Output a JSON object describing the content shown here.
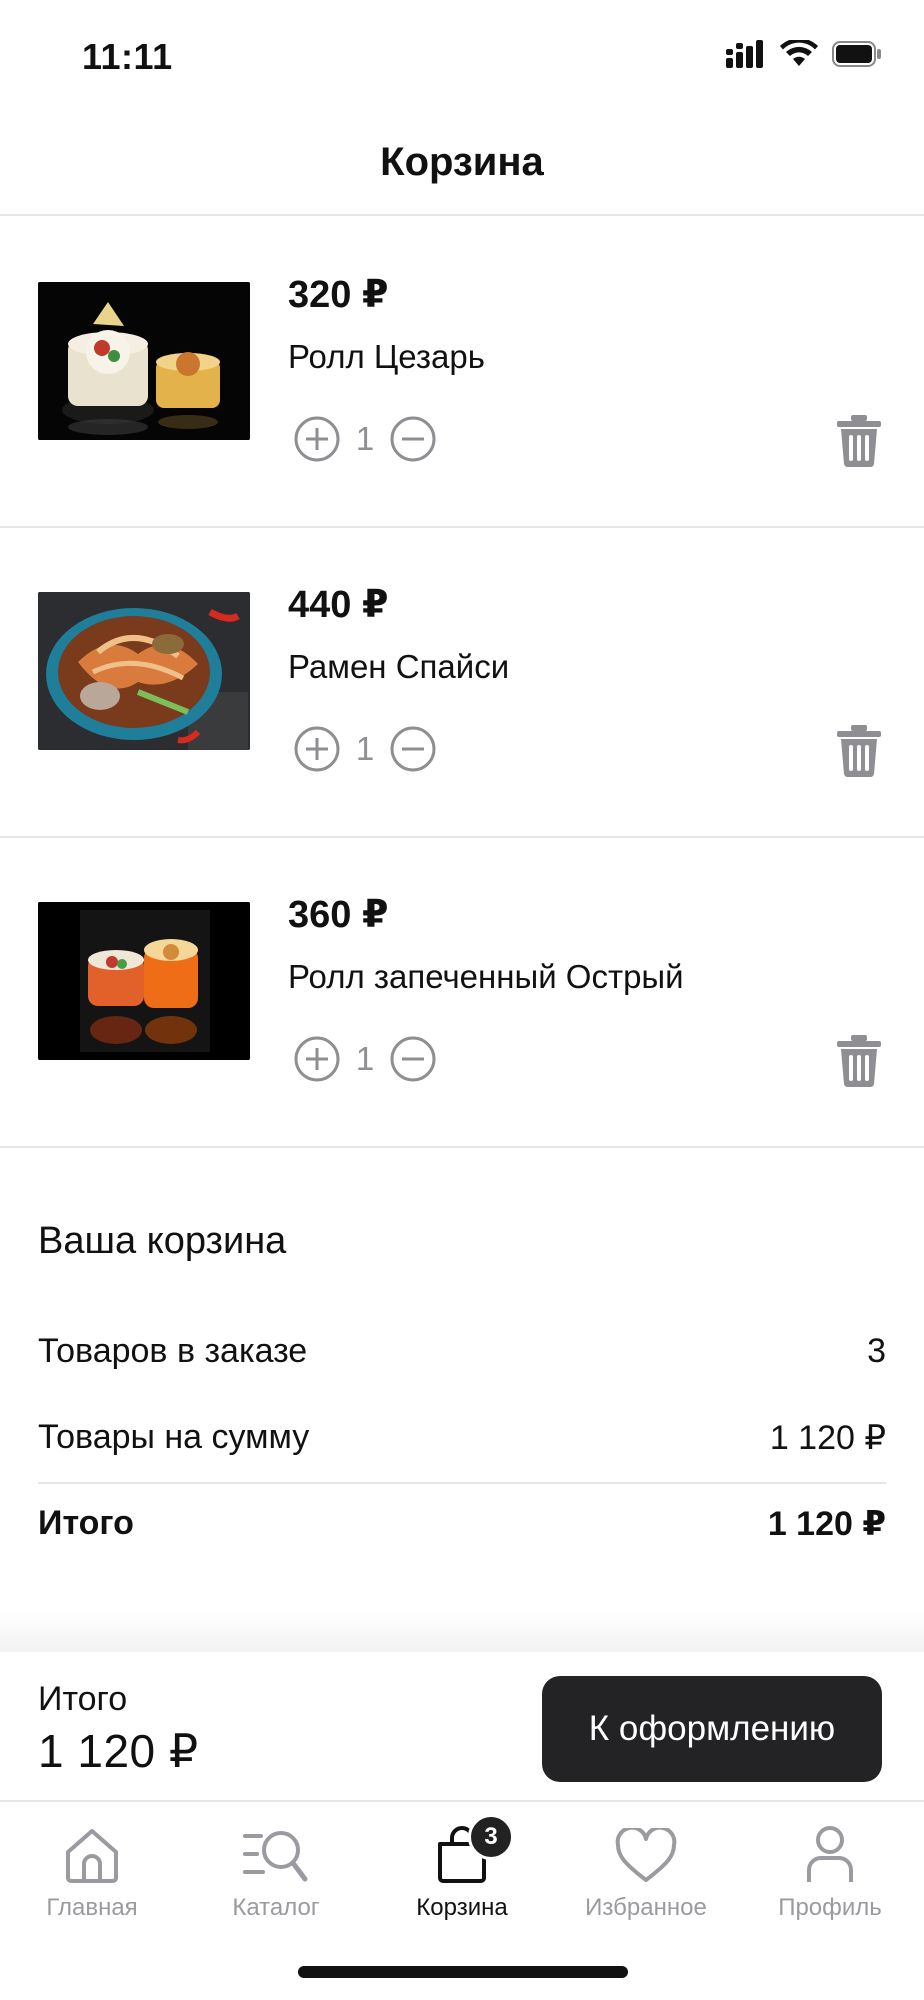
{
  "status_bar": {
    "time": "11:11"
  },
  "header": {
    "title": "Корзина"
  },
  "cart": {
    "items": [
      {
        "price": "320 ₽",
        "name": "Ролл Цезарь",
        "quantity": "1",
        "image": "roll-caesar-photo"
      },
      {
        "price": "440 ₽",
        "name": "Рамен Спайси",
        "quantity": "1",
        "image": "ramen-spicy-photo"
      },
      {
        "price": "360 ₽",
        "name": "Ролл запеченный Острый",
        "quantity": "1",
        "image": "baked-spicy-roll-photo"
      }
    ]
  },
  "summary": {
    "title": "Ваша корзина",
    "items_count_label": "Товаров в заказе",
    "items_count_value": "3",
    "subtotal_label": "Товары на сумму",
    "subtotal_value": "1 120 ₽",
    "total_label": "Итого",
    "total_value": "1 120 ₽"
  },
  "checkout": {
    "total_label": "Итого",
    "total_value": "1 120 ₽",
    "button_label": "К оформлению"
  },
  "tabs": [
    {
      "label": "Главная",
      "icon": "home-icon"
    },
    {
      "label": "Каталог",
      "icon": "catalog-search-icon"
    },
    {
      "label": "Корзина",
      "icon": "bag-icon",
      "badge": "3",
      "active": true
    },
    {
      "label": "Избранное",
      "icon": "heart-icon"
    },
    {
      "label": "Профиль",
      "icon": "profile-icon"
    }
  ],
  "colors": {
    "accent_dark": "#232325",
    "muted": "#8e8e93",
    "divider": "#e6e6e8"
  }
}
